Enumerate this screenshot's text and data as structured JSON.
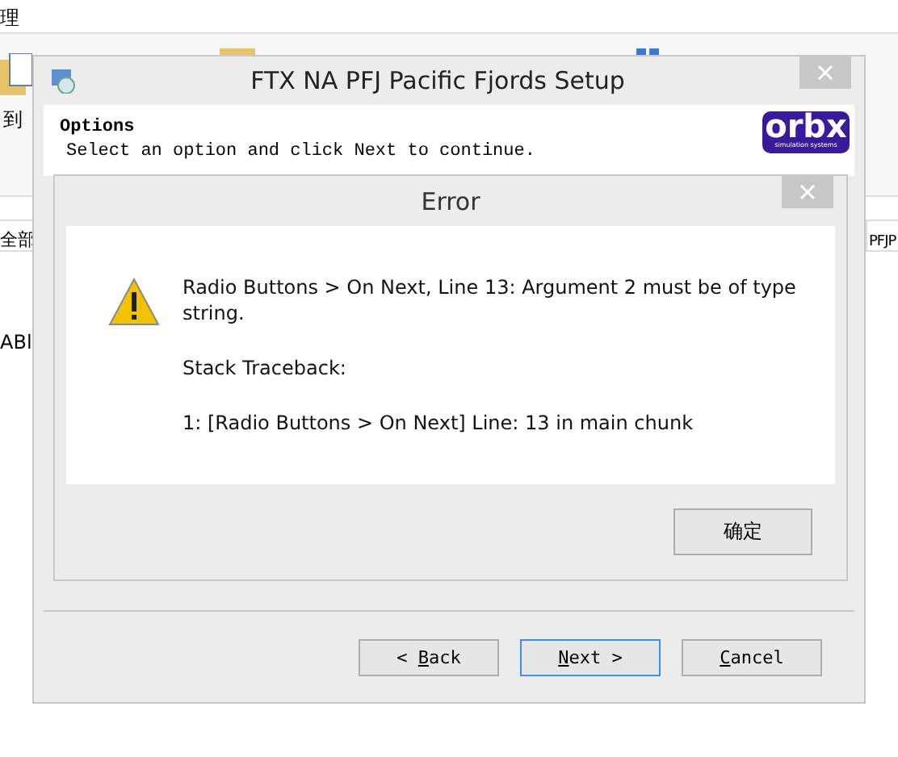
{
  "background_window": {
    "menu_tab": "理",
    "ribbon_label": "到",
    "address_text": "全部",
    "side_text": "PFJP",
    "list_item": "ABl"
  },
  "setup_window": {
    "title": "FTX NA PFJ Pacific Fjords Setup",
    "header_title": "Options",
    "header_subtitle": "Select an option and click Next to continue.",
    "logo_text": "orbx",
    "logo_subtext": "simulation systems",
    "buttons": [
      {
        "label": "< Back",
        "focused": false
      },
      {
        "label": "Next >",
        "focused": true
      },
      {
        "label": "Cancel",
        "focused": false
      }
    ]
  },
  "error_dialog": {
    "title": "Error",
    "message": "Radio Buttons > On Next, Line 13: Argument 2 must be of type string.",
    "traceback_title": "Stack Traceback:",
    "traceback_line": "1: [Radio Buttons > On Next] Line: 13 in main chunk",
    "button": "确定"
  }
}
